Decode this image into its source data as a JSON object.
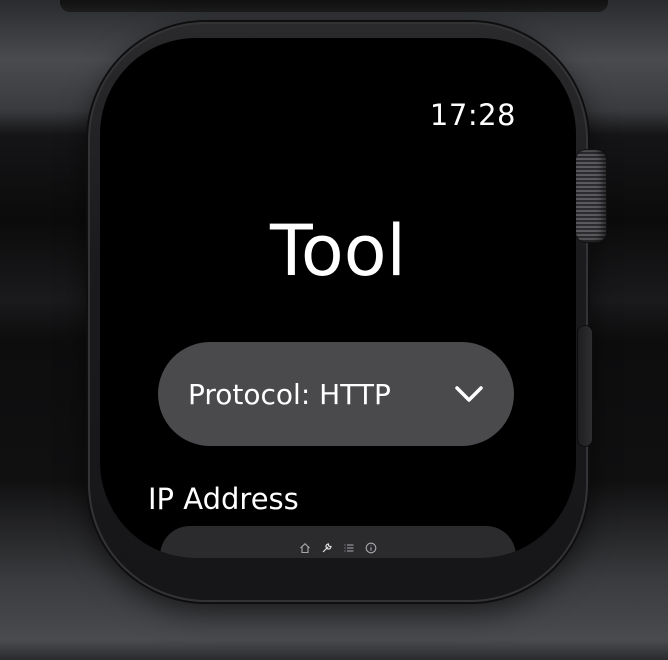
{
  "status_bar": {
    "time": "17:28"
  },
  "screen": {
    "title": "Tool",
    "protocol_picker": {
      "label": "Protocol: HTTP",
      "icon": "chevron-down-icon"
    },
    "ip_address": {
      "label": "IP Address",
      "value": ""
    }
  },
  "tab_bar": {
    "items": [
      {
        "icon": "home-icon"
      },
      {
        "icon": "wrench-icon"
      },
      {
        "icon": "list-icon"
      },
      {
        "icon": "info-icon"
      }
    ]
  },
  "colors": {
    "screen_bg": "#000000",
    "picker_bg": "#4a4a4d",
    "input_bg": "#2b2b2e",
    "text": "#ffffff"
  }
}
